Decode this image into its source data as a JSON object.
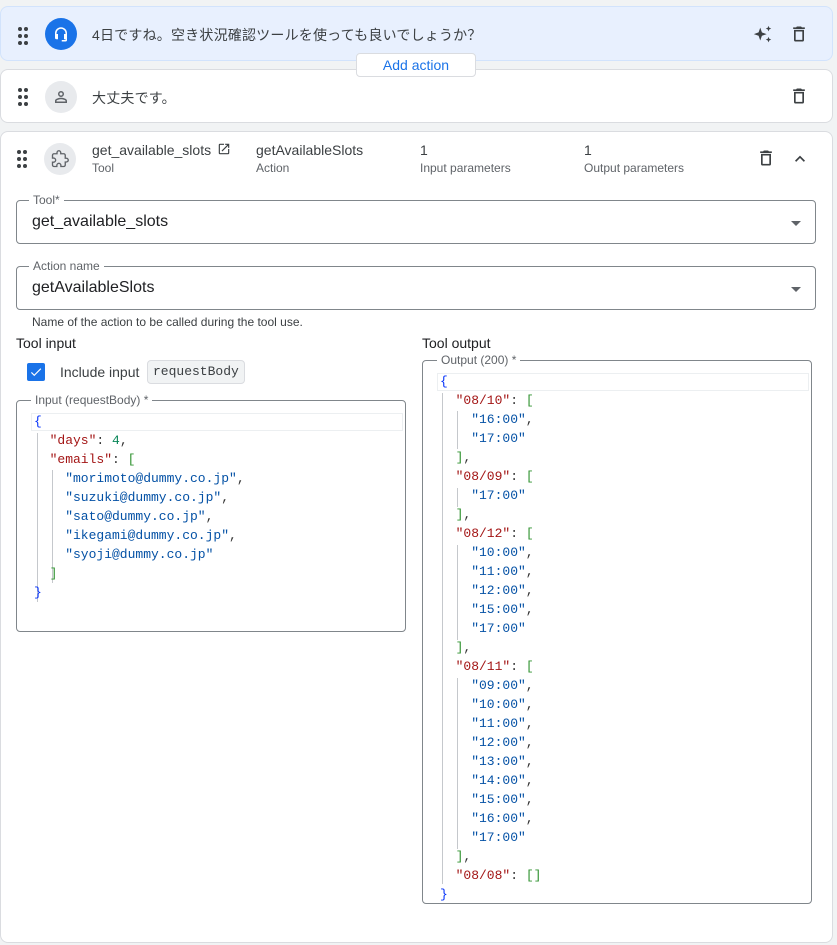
{
  "agent_message": {
    "text": "4日ですね。空き状況確認ツールを使っても良いでしょうか？"
  },
  "add_action_label": "Add action",
  "user_message": {
    "text": "大丈夫です。"
  },
  "tool_step": {
    "tool_name": "get_available_slots",
    "tool_caption": "Tool",
    "action_value": "getAvailableSlots",
    "action_caption": "Action",
    "input_count": "1",
    "input_caption": "Input parameters",
    "output_count": "1",
    "output_caption": "Output parameters"
  },
  "tool_field": {
    "label": "Tool*",
    "value": "get_available_slots"
  },
  "action_field": {
    "label": "Action name",
    "value": "getAvailableSlots",
    "hint": "Name of the action to be called during the tool use."
  },
  "tool_input": {
    "title": "Tool input",
    "include_label": "Include input",
    "include_checked": true,
    "include_param": "requestBody",
    "box_label": "Input (requestBody) *",
    "json": {
      "days": "4",
      "emails": [
        "morimoto@dummy.co.jp",
        "suzuki@dummy.co.jp",
        "sato@dummy.co.jp",
        "ikegami@dummy.co.jp",
        "syoji@dummy.co.jp"
      ]
    }
  },
  "tool_output": {
    "title": "Tool output",
    "box_label": "Output (200) *",
    "json": [
      {
        "key": "08/10",
        "slots": [
          "16:00",
          "17:00"
        ]
      },
      {
        "key": "08/09",
        "slots": [
          "17:00"
        ]
      },
      {
        "key": "08/12",
        "slots": [
          "10:00",
          "11:00",
          "12:00",
          "15:00",
          "17:00"
        ]
      },
      {
        "key": "08/11",
        "slots": [
          "09:00",
          "10:00",
          "11:00",
          "12:00",
          "13:00",
          "14:00",
          "15:00",
          "16:00",
          "17:00"
        ]
      },
      {
        "key": "08/08",
        "slots": []
      }
    ]
  },
  "colors": {
    "accent": "#1a73e8",
    "agent_bg": "#e8f0fe",
    "json_key": "#a31515",
    "json_string": "#0451a5",
    "json_number": "#098658"
  },
  "icons": [
    "drag-handle-icon",
    "support-agent-icon",
    "person-icon",
    "extension-icon",
    "open-in-new-icon",
    "auto-awesome-icon",
    "delete-icon",
    "expand-less-icon",
    "check-icon"
  ]
}
